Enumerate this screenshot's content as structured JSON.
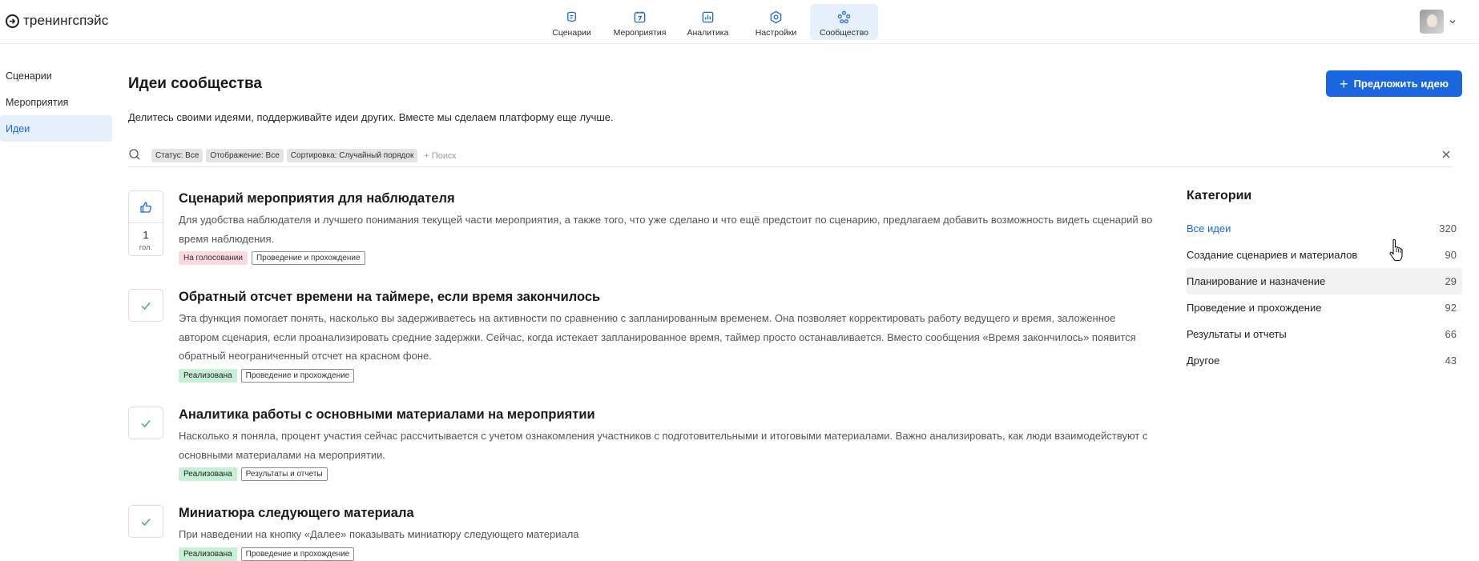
{
  "header": {
    "logo_text": "тренингспэйс",
    "nav": [
      {
        "label": "Сценарии",
        "icon": "scenarios-icon"
      },
      {
        "label": "Мероприятия",
        "icon": "calendar-icon"
      },
      {
        "label": "Аналитика",
        "icon": "analytics-icon"
      },
      {
        "label": "Настройки",
        "icon": "settings-icon"
      },
      {
        "label": "Сообщество",
        "icon": "community-icon"
      }
    ],
    "active_nav": "Сообщество"
  },
  "sidebar": {
    "items": [
      {
        "label": "Сценарии"
      },
      {
        "label": "Мероприятия"
      },
      {
        "label": "Идеи"
      }
    ],
    "active_item": "Идеи"
  },
  "main": {
    "title": "Идеи сообщества",
    "subtitle": "Делитесь своими идеями, поддерживайте идеи других. Вместе мы сделаем платформу еще лучше.",
    "suggest_button": "Предложить идею",
    "filters": [
      "Статус: Все",
      "Отображение: Все",
      "Сортировка: Случайный порядок"
    ],
    "search_placeholder": "+ Поиск"
  },
  "ideas": [
    {
      "title": "Сценарий мероприятия для наблюдателя",
      "description": "Для удобства наблюдателя и лучшего понимания текущей части мероприятия, а также того, что уже сделано и что ещё предстоит по сценарию, предлагаем добавить возможность видеть сценарий во время наблюдения.",
      "status": "На голосовании",
      "category": "Проведение и прохождение",
      "votes": "1",
      "votes_unit": "гол."
    },
    {
      "title": "Обратный отсчет времени на таймере, если время закончилось",
      "description": "Эта функция помогает понять, насколько вы задерживаетесь на активности по сравнению с запланированным временем. Она позволяет корректировать работу ведущего и время, заложенное автором сценария, если проанализировать средние задержки. Сейчас, когда истекает запланированное время, таймер просто останавливается. Вместо сообщения «Время закончилось» появится обратный неограниченный отсчет на красном фоне.",
      "status": "Реализована",
      "category": "Проведение и прохождение"
    },
    {
      "title": "Аналитика работы с основными материалами на мероприятии",
      "description": "Насколько я поняла, процент участия сейчас рассчитывается с учетом ознакомления участников с подготовительными и итоговыми материалами. Важно анализировать, как люди взаимодействуют с основными материалами на мероприятии.",
      "status": "Реализована",
      "category": "Результаты и отчеты"
    },
    {
      "title": "Миниатюра следующего материала",
      "description": "При наведении на кнопку «Далее» показывать миниатюру следующего материала",
      "status": "Реализована",
      "category": "Проведение и прохождение"
    }
  ],
  "categories": {
    "title": "Категории",
    "items": [
      {
        "name": "Все идеи",
        "count": "320"
      },
      {
        "name": "Создание сценариев и материалов",
        "count": "90"
      },
      {
        "name": "Планирование и назначение",
        "count": "29"
      },
      {
        "name": "Проведение и прохождение",
        "count": "92"
      },
      {
        "name": "Результаты и отчеты",
        "count": "66"
      },
      {
        "name": "Другое",
        "count": "43"
      }
    ],
    "active_item": "Все идеи",
    "hovered_item": "Планирование и назначение"
  },
  "colors": {
    "accent": "#1a66e0",
    "accent_light": "#e6f0fd",
    "status_voting": "#fbd9df",
    "status_done": "#c7efd5",
    "check_green": "#3db46d"
  }
}
